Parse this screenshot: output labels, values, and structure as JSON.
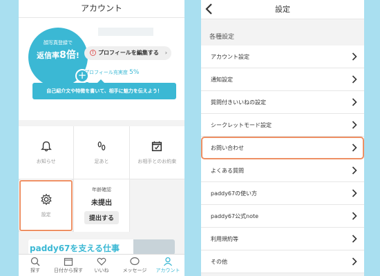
{
  "left": {
    "title": "アカウント",
    "avatar": {
      "line1": "顔写真登録で",
      "line2_prefix": "返信率",
      "line2_num": "8倍",
      "line2_suffix": "!",
      "plus": "+"
    },
    "edit_profile": {
      "warn": "!",
      "label": "プロフィールを編集する",
      "chevron": "›"
    },
    "progress": {
      "label": "プロフィール充実度",
      "value_text": "5%",
      "value": 0.05
    },
    "tooltip": "自己紹介文や特徴を書いて、相手に魅力を伝えよう！",
    "grid": [
      {
        "label": "お知らせ",
        "icon": "bell-icon"
      },
      {
        "label": "足あと",
        "icon": "footprints-icon"
      },
      {
        "label": "お相手とのお約束",
        "icon": "calendar-icon"
      },
      {
        "label": "設定",
        "icon": "gear-icon"
      }
    ],
    "age_verify": {
      "title": "年齢確認",
      "status": "未提出",
      "button": "提出する"
    },
    "banner": "paddy67を支える仕事",
    "tabs": [
      {
        "label": "探す",
        "icon": "search-icon"
      },
      {
        "label": "日付から探す",
        "icon": "calendar-icon"
      },
      {
        "label": "いいね",
        "icon": "heart-icon"
      },
      {
        "label": "メッセージ",
        "icon": "chat-icon"
      },
      {
        "label": "アカウント",
        "icon": "user-icon"
      }
    ]
  },
  "right": {
    "title": "設定",
    "section": "各種設定",
    "items": [
      "アカウント設定",
      "通知設定",
      "質問付きいいねの設定",
      "シークレットモード設定",
      "お問い合わせ",
      "よくある質問",
      "paddy67の使い方",
      "paddy67公式note",
      "利用規約等",
      "その他"
    ]
  },
  "colors": {
    "accent": "#3bb8d4",
    "highlight": "#ee8f63",
    "background": "#a9dff0"
  }
}
